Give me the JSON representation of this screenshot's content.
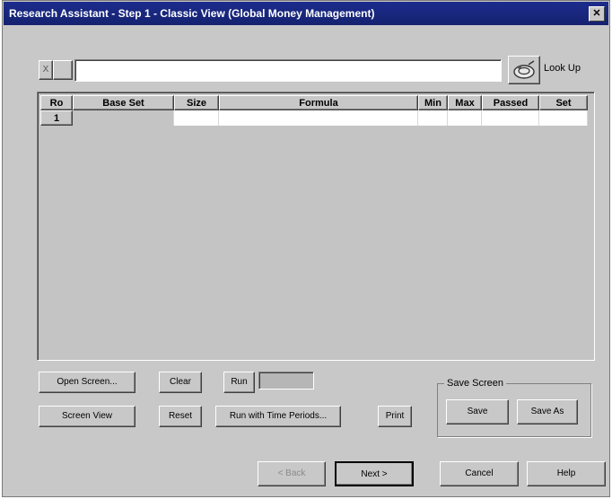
{
  "window": {
    "title": "Research Assistant - Step 1 - Classic View   (Global Money Management)",
    "close_glyph": "✕"
  },
  "formula_bar": {
    "small_box_label": "X",
    "input_value": "",
    "lookup_label": "Look Up"
  },
  "grid": {
    "columns": [
      "Ro",
      "Base Set",
      "Size",
      "Formula",
      "Min",
      "Max",
      "Passed",
      "Set"
    ],
    "rows": [
      {
        "row": "1",
        "base_set": "",
        "size": "",
        "formula": "",
        "min": "",
        "max": "",
        "passed": "",
        "set": ""
      }
    ]
  },
  "buttons": {
    "open_screen": "Open Screen...",
    "clear": "Clear",
    "run": "Run",
    "screen_view": "Screen View",
    "reset": "Reset",
    "run_time_periods": "Run with Time Periods...",
    "print": "Print",
    "save": "Save",
    "save_as": "Save As",
    "back": "< Back",
    "next": "Next >",
    "cancel": "Cancel",
    "help": "Help"
  },
  "save_group": {
    "label": "Save Screen"
  },
  "colors": {
    "titlebar": "#1c2c8c",
    "face": "#c8c8c8"
  }
}
